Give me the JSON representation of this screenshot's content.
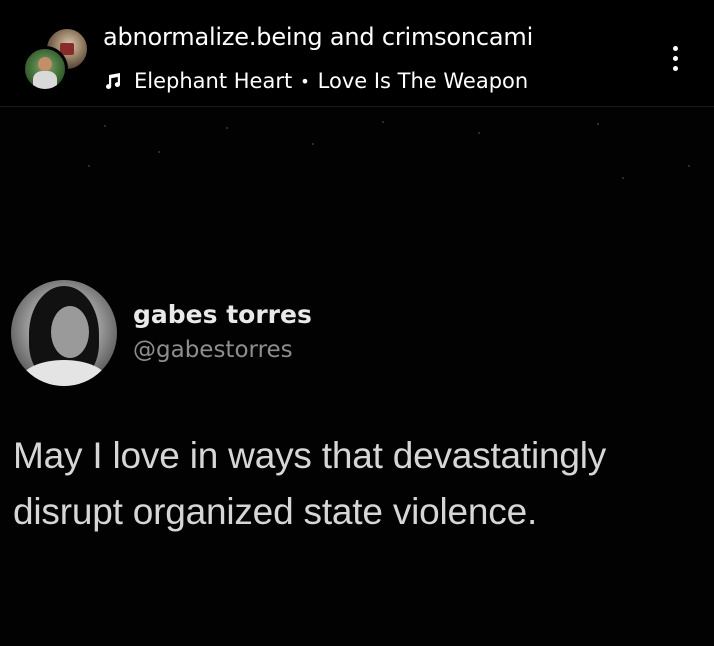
{
  "header": {
    "usernames": "abnormalize.being and crimsoncami",
    "music": {
      "icon": "music-note-icon",
      "artist": "Elephant Heart",
      "separator": "•",
      "song": "Love Is The Weapon"
    },
    "more_icon": "more-vertical-icon"
  },
  "tweet": {
    "display_name": "gabes torres",
    "handle": "@gabestorres",
    "text": "May I love in ways that devastatingly disrupt organized state violence."
  },
  "colors": {
    "background": "#000000",
    "text_primary": "#ffffff",
    "tweet_text": "#d6d6d6",
    "handle": "#8e8e8e"
  }
}
